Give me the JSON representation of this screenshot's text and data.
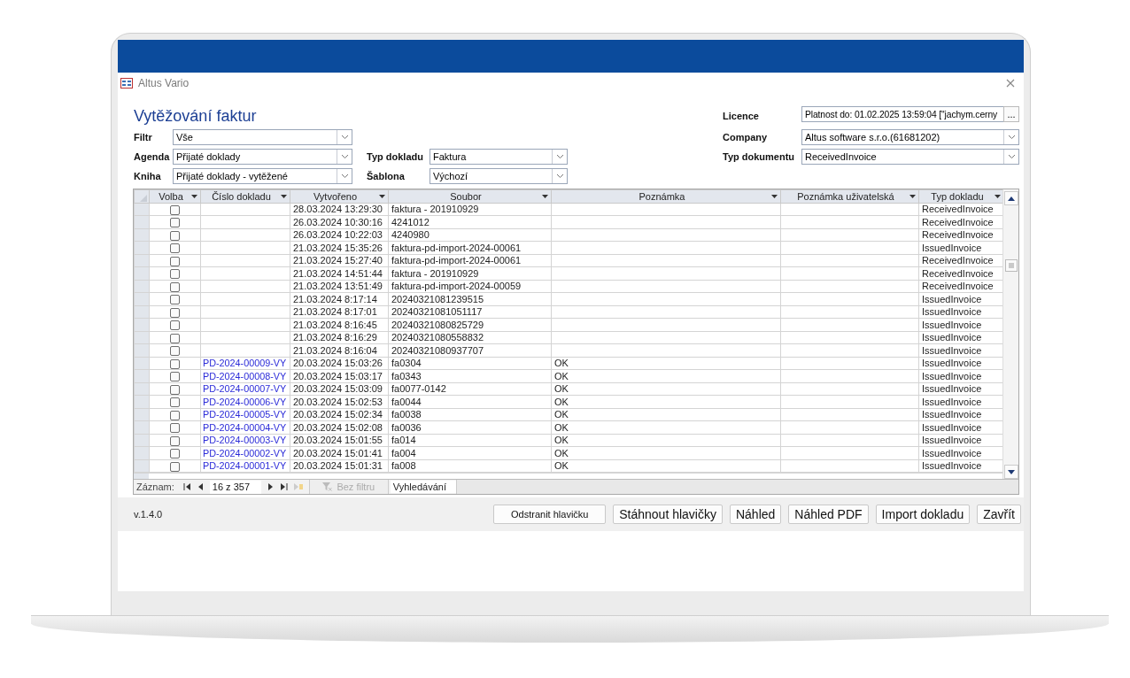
{
  "window": {
    "title": "Altus Vario"
  },
  "form": {
    "title": "Vytěžování faktur",
    "left_fields": [
      {
        "label": "Filtr",
        "value": "Vše",
        "kind": "combo"
      },
      {
        "label": "Agenda",
        "value": "Přijaté doklady",
        "kind": "combo"
      },
      {
        "label": "Kniha",
        "value": "Přijaté doklady - vytěžené",
        "kind": "combo"
      }
    ],
    "middle_fields": [
      {
        "label": "Typ dokladu",
        "value": "Faktura",
        "kind": "combo"
      },
      {
        "label": "Šablona",
        "value": "Výchozí",
        "kind": "combo"
      }
    ],
    "right_fields": [
      {
        "label": "Licence",
        "value": "Platnost do: 01.02.2025 13:59:04 [\"jachym.cerny",
        "kind": "text_button",
        "button": "..."
      },
      {
        "label": "Company",
        "value": "Altus software s.r.o.(61681202)",
        "kind": "combo"
      },
      {
        "label": "Typ dokumentu",
        "value": "ReceivedInvoice",
        "kind": "combo"
      }
    ]
  },
  "table": {
    "columns": [
      {
        "label": "Volba"
      },
      {
        "label": "Číslo dokladu"
      },
      {
        "label": "Vytvořeno"
      },
      {
        "label": "Soubor"
      },
      {
        "label": "Poznámka"
      },
      {
        "label": "Poznámka uživatelská"
      },
      {
        "label": "Typ dokladu"
      }
    ],
    "rows": [
      {
        "checked": false,
        "number": "",
        "created": "28.03.2024 13:29:30",
        "file": "faktura - 201910929",
        "note": "",
        "user_note": "",
        "doc_type": "ReceivedInvoice"
      },
      {
        "checked": false,
        "number": "",
        "created": "26.03.2024 10:30:16",
        "file": "4241012",
        "note": "",
        "user_note": "",
        "doc_type": "ReceivedInvoice"
      },
      {
        "checked": false,
        "number": "",
        "created": "26.03.2024 10:22:03",
        "file": "4240980",
        "note": "",
        "user_note": "",
        "doc_type": "ReceivedInvoice"
      },
      {
        "checked": false,
        "number": "",
        "created": "21.03.2024 15:35:26",
        "file": "faktura-pd-import-2024-00061",
        "note": "",
        "user_note": "",
        "doc_type": "IssuedInvoice"
      },
      {
        "checked": false,
        "number": "",
        "created": "21.03.2024 15:27:40",
        "file": "faktura-pd-import-2024-00061",
        "note": "",
        "user_note": "",
        "doc_type": "ReceivedInvoice"
      },
      {
        "checked": false,
        "number": "",
        "created": "21.03.2024 14:51:44",
        "file": "faktura - 201910929",
        "note": "",
        "user_note": "",
        "doc_type": "ReceivedInvoice"
      },
      {
        "checked": false,
        "number": "",
        "created": "21.03.2024 13:51:49",
        "file": "faktura-pd-import-2024-00059",
        "note": "",
        "user_note": "",
        "doc_type": "ReceivedInvoice"
      },
      {
        "checked": false,
        "number": "",
        "created": "21.03.2024 8:17:14",
        "file": "20240321081239515",
        "note": "",
        "user_note": "",
        "doc_type": "IssuedInvoice"
      },
      {
        "checked": false,
        "number": "",
        "created": "21.03.2024 8:17:01",
        "file": "20240321081051117",
        "note": "",
        "user_note": "",
        "doc_type": "IssuedInvoice"
      },
      {
        "checked": false,
        "number": "",
        "created": "21.03.2024 8:16:45",
        "file": "20240321080825729",
        "note": "",
        "user_note": "",
        "doc_type": "IssuedInvoice"
      },
      {
        "checked": false,
        "number": "",
        "created": "21.03.2024 8:16:29",
        "file": "20240321080558832",
        "note": "",
        "user_note": "",
        "doc_type": "IssuedInvoice"
      },
      {
        "checked": false,
        "number": "",
        "created": "21.03.2024 8:16:04",
        "file": "20240321080937707",
        "note": "",
        "user_note": "",
        "doc_type": "IssuedInvoice"
      },
      {
        "checked": false,
        "number": "PD-2024-00009-VY",
        "created": "20.03.2024 15:03:26",
        "file": "fa0304",
        "note": "OK",
        "user_note": "",
        "doc_type": "IssuedInvoice"
      },
      {
        "checked": false,
        "number": "PD-2024-00008-VY",
        "created": "20.03.2024 15:03:17",
        "file": "fa0343",
        "note": "OK",
        "user_note": "",
        "doc_type": "IssuedInvoice"
      },
      {
        "checked": false,
        "number": "PD-2024-00007-VY",
        "created": "20.03.2024 15:03:09",
        "file": "fa0077-0142",
        "note": "OK",
        "user_note": "",
        "doc_type": "IssuedInvoice"
      },
      {
        "checked": false,
        "number": "PD-2024-00006-VY",
        "created": "20.03.2024 15:02:53",
        "file": "fa0044",
        "note": "OK",
        "user_note": "",
        "doc_type": "IssuedInvoice"
      },
      {
        "checked": false,
        "number": "PD-2024-00005-VY",
        "created": "20.03.2024 15:02:34",
        "file": "fa0038",
        "note": "OK",
        "user_note": "",
        "doc_type": "IssuedInvoice"
      },
      {
        "checked": false,
        "number": "PD-2024-00004-VY",
        "created": "20.03.2024 15:02:08",
        "file": "fa0036",
        "note": "OK",
        "user_note": "",
        "doc_type": "IssuedInvoice"
      },
      {
        "checked": false,
        "number": "PD-2024-00003-VY",
        "created": "20.03.2024 15:01:55",
        "file": "fa014",
        "note": "OK",
        "user_note": "",
        "doc_type": "IssuedInvoice"
      },
      {
        "checked": false,
        "number": "PD-2024-00002-VY",
        "created": "20.03.2024 15:01:41",
        "file": "fa004",
        "note": "OK",
        "user_note": "",
        "doc_type": "IssuedInvoice"
      },
      {
        "checked": false,
        "number": "PD-2024-00001-VY",
        "created": "20.03.2024 15:01:31",
        "file": "fa008",
        "note": "OK",
        "user_note": "",
        "doc_type": "IssuedInvoice"
      }
    ]
  },
  "record_nav": {
    "label": "Záznam:",
    "position": "16 z 357",
    "filter": "Bez filtru",
    "search_placeholder": "Vyhledávání"
  },
  "version": "v.1.4.0",
  "buttons": [
    {
      "label": "Odstranit hlavičku",
      "kind": "small"
    },
    {
      "label": "Stáhnout hlavičky",
      "kind": "normal"
    },
    {
      "label": "Náhled",
      "kind": "normal"
    },
    {
      "label": "Náhled PDF",
      "kind": "normal"
    },
    {
      "label": "Import dokladu",
      "kind": "normal"
    },
    {
      "label": "Zavřít",
      "kind": "normal"
    }
  ]
}
